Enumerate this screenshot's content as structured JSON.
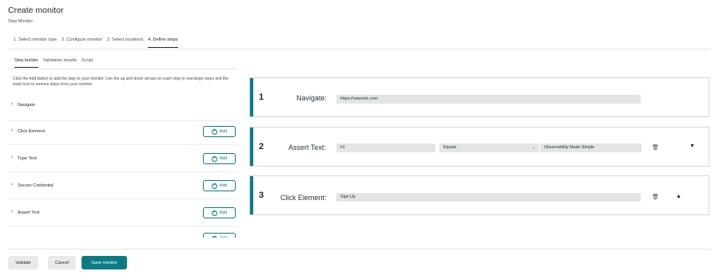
{
  "header": {
    "title": "Create monitor",
    "subtitle": "Step Monitor"
  },
  "wizard": [
    "1. Select monitor type",
    "2. Configure monitor",
    "3. Select locations",
    "4. Define steps"
  ],
  "subtabs": [
    "Step builder",
    "Validation results",
    "Script"
  ],
  "instructions": "Click the Add button to add the step to your monitor. Use the up and down arrows on each step to rearrange steps and the trash icon to remove steps from your monitor.",
  "step_types": {
    "add_label": "Add",
    "items": [
      "Navigate",
      "Click Element",
      "Type Text",
      "Secure Credential",
      "Assert Text"
    ]
  },
  "steps": [
    {
      "number": "1",
      "type": "Navigate:",
      "url": "https://newrelic.com"
    },
    {
      "number": "2",
      "type": "Assert Text:",
      "selector": "h1",
      "condition": "Equals",
      "value": "Observability Made Simple"
    },
    {
      "number": "3",
      "type": "Click Element:",
      "selector": "Sign Up"
    }
  ],
  "footer": {
    "validate": "Validate",
    "cancel": "Cancel",
    "save": "Save monitor"
  },
  "icons": {
    "chevron": "chevron-right-icon",
    "plus": "plus-circle-icon",
    "trash": "trash-icon",
    "caret_down": "caret-down-icon",
    "caret_up": "caret-up-icon"
  },
  "colors": {
    "accent": "#0c7c84",
    "field_bg": "#e3e4e4",
    "border": "#d5d7d7"
  }
}
